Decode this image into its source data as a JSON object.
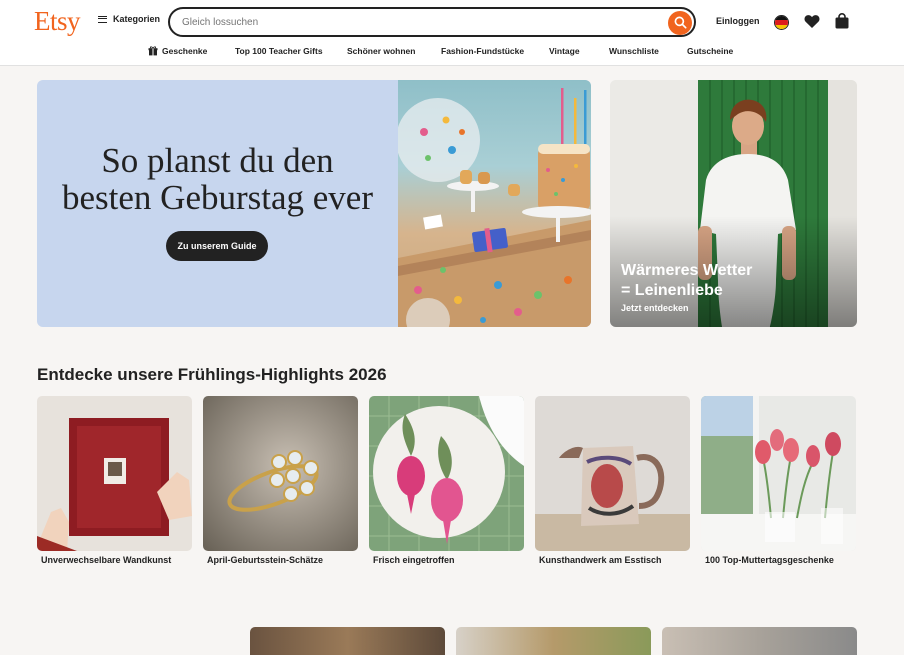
{
  "header": {
    "logo": "Etsy",
    "categories_label": "Kategorien",
    "search_placeholder": "Gleich lossuchen",
    "login_label": "Einloggen",
    "flag_icon": "germany-flag-icon",
    "brand_color": "#f1641e"
  },
  "nav": {
    "items": [
      {
        "label": "Geschenke",
        "icon": "gift-icon"
      },
      {
        "label": "Top 100 Teacher Gifts"
      },
      {
        "label": "Schöner wohnen"
      },
      {
        "label": "Fashion-Fundstücke"
      },
      {
        "label": "Vintage"
      },
      {
        "label": "Wunschliste"
      },
      {
        "label": "Gutscheine"
      }
    ]
  },
  "hero": {
    "title_line1": "So planst du den",
    "title_line2": "besten Geburstag ever",
    "button_label": "Zu unserem Guide",
    "background": "#c7d6ee"
  },
  "side_banner": {
    "title_line1": "Wärmeres Wetter",
    "title_line2": "= Leinenliebe",
    "subtitle": "Jetzt entdecken"
  },
  "highlights": {
    "title": "Entdecke unsere Frühlings-Highlights 2026",
    "cards": [
      {
        "label": "Unverwechselbare Wandkunst"
      },
      {
        "label": "April-Geburtsstein-Schätze"
      },
      {
        "label": "Frisch eingetroffen"
      },
      {
        "label": "Kunsthandwerk am Esstisch"
      },
      {
        "label": "100 Top-Muttertagsgeschenke"
      }
    ]
  }
}
